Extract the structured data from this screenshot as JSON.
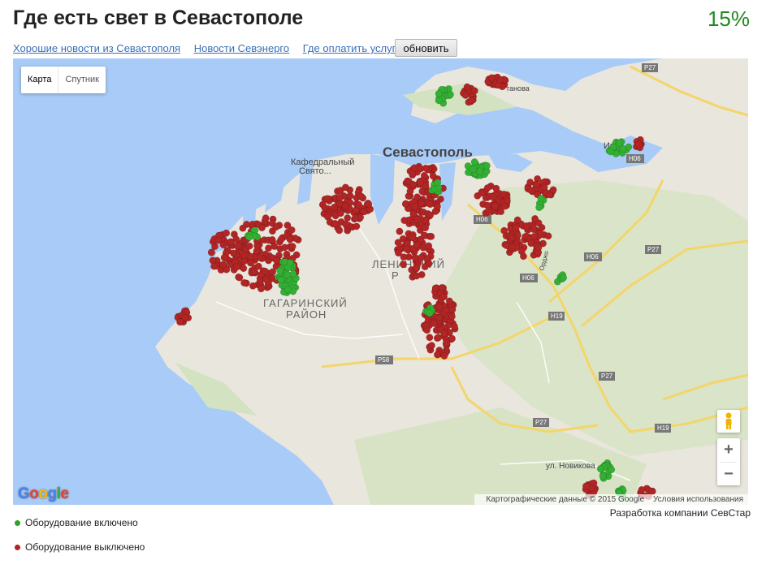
{
  "header": {
    "title": "Где есть свет в Севастополе",
    "percent": "15%"
  },
  "links": [
    {
      "label": "Хорошие новости из Севастополя"
    },
    {
      "label": "Новости Севэнерго"
    },
    {
      "label": "Где оплатить услуги"
    }
  ],
  "refresh_label": "обновить",
  "map": {
    "type_buttons": [
      "Карта",
      "Спутник"
    ],
    "labels": {
      "city": "Севастополь",
      "cathedral": "Кафедральный",
      "cathedral2": "Свято...",
      "district1": "ГАГАРИНСКИЙ",
      "district1b": "РАЙОН",
      "district2": "ЛЕНИНСКИЙ",
      "district2b": "Р",
      "street_novikova": "ул. Новикова",
      "street_ordzh": "Орджо",
      "street_anova": "ганова",
      "inker": "Инке"
    },
    "roads": [
      "P27",
      "H06",
      "H06",
      "H06",
      "P27",
      "H19",
      "P58",
      "P27",
      "P27",
      "H19",
      "H06"
    ],
    "google_logo": "Google",
    "attribution": {
      "data": "Картографические данные © 2015 Google",
      "terms": "Условия использования"
    },
    "zoom_in": "+",
    "zoom_out": "−"
  },
  "credit": "Разработка компании СевСтар",
  "legend": [
    {
      "label": "Оборудование включено",
      "color": "#2aa52a"
    },
    {
      "label": "Оборудование выключено",
      "color": "#b22222"
    }
  ],
  "colors": {
    "on": "#33b033",
    "off": "#b22525",
    "percent": "#1f8a1f",
    "link": "#3b6fb6"
  }
}
